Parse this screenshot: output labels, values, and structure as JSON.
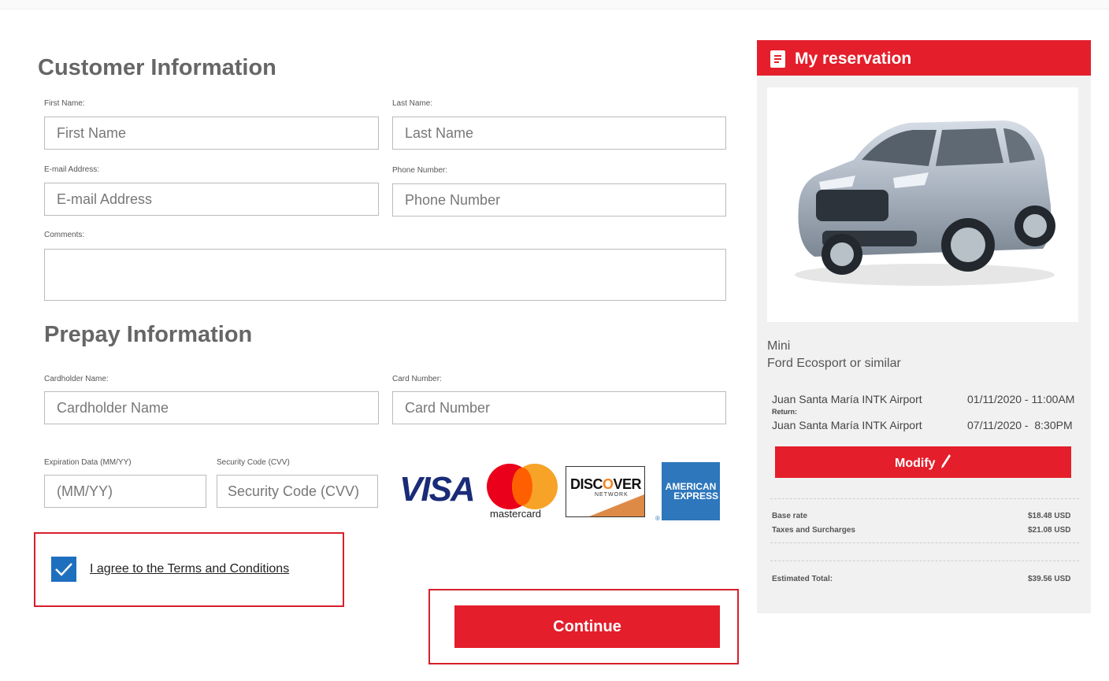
{
  "customer": {
    "title": "Customer Information",
    "first_name_label": "First Name:",
    "first_name_placeholder": "First Name",
    "last_name_label": "Last Name:",
    "last_name_placeholder": "Last Name",
    "email_label": "E-mail Address:",
    "email_placeholder": "E-mail Address",
    "phone_label": "Phone Number:",
    "phone_placeholder": "Phone Number",
    "comments_label": "Comments:"
  },
  "prepay": {
    "title": "Prepay Information",
    "cardholder_label": "Cardholder Name:",
    "cardholder_placeholder": "Cardholder Name",
    "card_number_label": "Card Number:",
    "card_number_placeholder": "Card Number",
    "expiration_label": "Expiration Data (MM/YY)",
    "expiration_placeholder": "(MM/YY)",
    "cvv_label": "Security Code (CVV)",
    "cvv_placeholder": "Security Code (CVV)",
    "logos": {
      "visa": "VISA",
      "mastercard": "mastercard",
      "discover_a": "DISC",
      "discover_o": "O",
      "discover_b": "VER",
      "discover_sub": "NETWORK",
      "amex_1": "AMERICAN",
      "amex_2": "EXPRESS",
      "reg": "®"
    }
  },
  "terms": {
    "label": "I agree to the Terms and Conditions",
    "checked": true
  },
  "continue_label": "Continue",
  "reservation": {
    "title": "My reservation",
    "car_class": "Mini",
    "car_model": "Ford Ecosport or similar",
    "pickup_location": "Juan Santa María INTK Airport",
    "pickup_datetime": "01/11/2020 - 11:00AM",
    "return_label": "Return:",
    "return_location": "Juan Santa María INTK Airport",
    "return_datetime": "07/11/2020 -  8:30PM",
    "modify_label": "Modify",
    "base_rate_label": "Base rate",
    "base_rate_value": "$18.48 USD",
    "taxes_label": "Taxes and Surcharges",
    "taxes_value": "$21.08 USD",
    "total_label": "Estimated Total:",
    "total_value": "$39.56 USD"
  },
  "colors": {
    "accent": "#e41e2b",
    "checkbox": "#1f6fbf",
    "sidebar_bg": "#f1f1f1"
  }
}
